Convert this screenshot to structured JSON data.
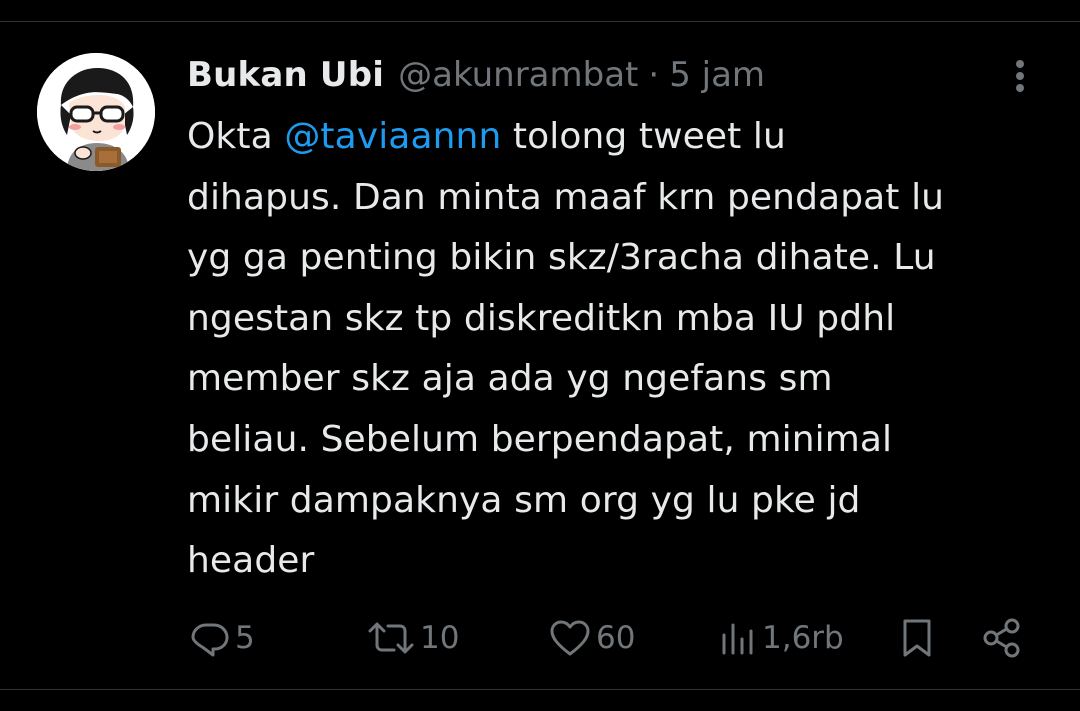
{
  "tweet": {
    "author": {
      "display_name": "Bukan Ubi",
      "handle": "@akunrambat"
    },
    "separator": "·",
    "time": "5 jam",
    "text": {
      "line1_before": "Okta ",
      "mention": "@taviaannn",
      "line1_after": " tolong tweet lu",
      "lines": [
        "dihapus. Dan minta maaf krn pendapat lu",
        "yg ga penting bikin skz/3racha dihate. Lu",
        "ngestan skz tp diskreditkn mba IU pdhl",
        "member skz aja ada yg ngefans sm",
        "beliau. Sebelum berpendapat, minimal",
        "mikir dampaknya sm org yg lu pke jd",
        "header"
      ]
    },
    "actions": {
      "replies": "5",
      "retweets": "10",
      "likes": "60",
      "views": "1,6rb"
    }
  },
  "colors": {
    "background": "#000000",
    "text": "#e7e9ea",
    "secondary": "#71767b",
    "mention": "#1d9bf0",
    "divider": "#2f3336"
  },
  "icons": [
    "more-icon",
    "reply-icon",
    "retweet-icon",
    "like-icon",
    "views-icon",
    "bookmark-icon",
    "share-icon"
  ]
}
